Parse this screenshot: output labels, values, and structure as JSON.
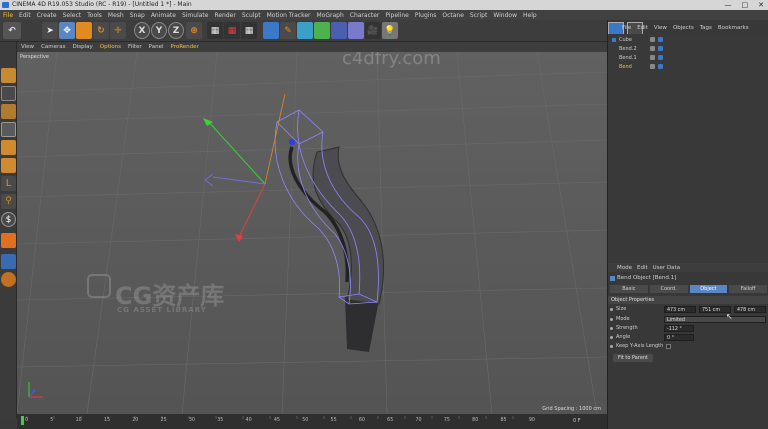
{
  "window": {
    "title": "CINEMA 4D R19.053 Studio (RC - R19) - [Untitled 1 *] - Main",
    "controls": [
      "—",
      "□",
      "✕"
    ]
  },
  "menu": {
    "items": [
      "File",
      "Edit",
      "Create",
      "Select",
      "Tools",
      "Mesh",
      "Snap",
      "Animate",
      "Simulate",
      "Render",
      "Sculpt",
      "Motion Tracker",
      "MoGraph",
      "Character",
      "Pipeline",
      "Plugins",
      "Octane",
      "Script",
      "Window",
      "Help"
    ]
  },
  "toolbar": {
    "axis_x": "X",
    "axis_y": "Y",
    "axis_z": "Z"
  },
  "viewport": {
    "menu": [
      "View",
      "Cameras",
      "Display",
      "Options",
      "Filter",
      "Panel",
      "ProRender"
    ],
    "label": "Perspective",
    "grid_spacing": "Grid Spacing : 1000 cm",
    "watermark_site": "c4dfry.com",
    "watermark_brand": "CG资产库",
    "watermark_sub": "CG ASSET LIBRARY"
  },
  "timeline": {
    "ticks": [
      "0",
      "5",
      "10",
      "15",
      "20",
      "25",
      "30",
      "35",
      "40",
      "45",
      "50",
      "55",
      "60",
      "65",
      "70",
      "75",
      "80",
      "85",
      "90"
    ],
    "frame": "0 F"
  },
  "objects": {
    "menu": [
      "File",
      "Edit",
      "View",
      "Objects",
      "Tags",
      "Bookmarks"
    ],
    "rows": [
      {
        "name": "Cube"
      },
      {
        "name": "Bend.2"
      },
      {
        "name": "Bend.1"
      },
      {
        "name": "Bend"
      }
    ]
  },
  "attributes": {
    "menu": [
      "Mode",
      "Edit",
      "User Data"
    ],
    "title": "Bend Object [Bend.1]",
    "tabs": [
      "Basic",
      "Coord.",
      "Object",
      "Falloff"
    ],
    "section": "Object Properties",
    "size_label": "Size",
    "size_values": [
      "473 cm",
      "751 cm",
      "478 cm"
    ],
    "mode_label": "Mode",
    "mode_value": "Limited",
    "strength_label": "Strength",
    "strength_value": "-112 °",
    "angle_label": "Angle",
    "angle_value": "0 °",
    "keep_label": "Keep Y-Axis Length",
    "fit_button": "Fit to Parent"
  },
  "colors": {
    "accent": "#f0c040",
    "active_tab": "#5a86c4",
    "selection_box": "#8f87ff"
  }
}
